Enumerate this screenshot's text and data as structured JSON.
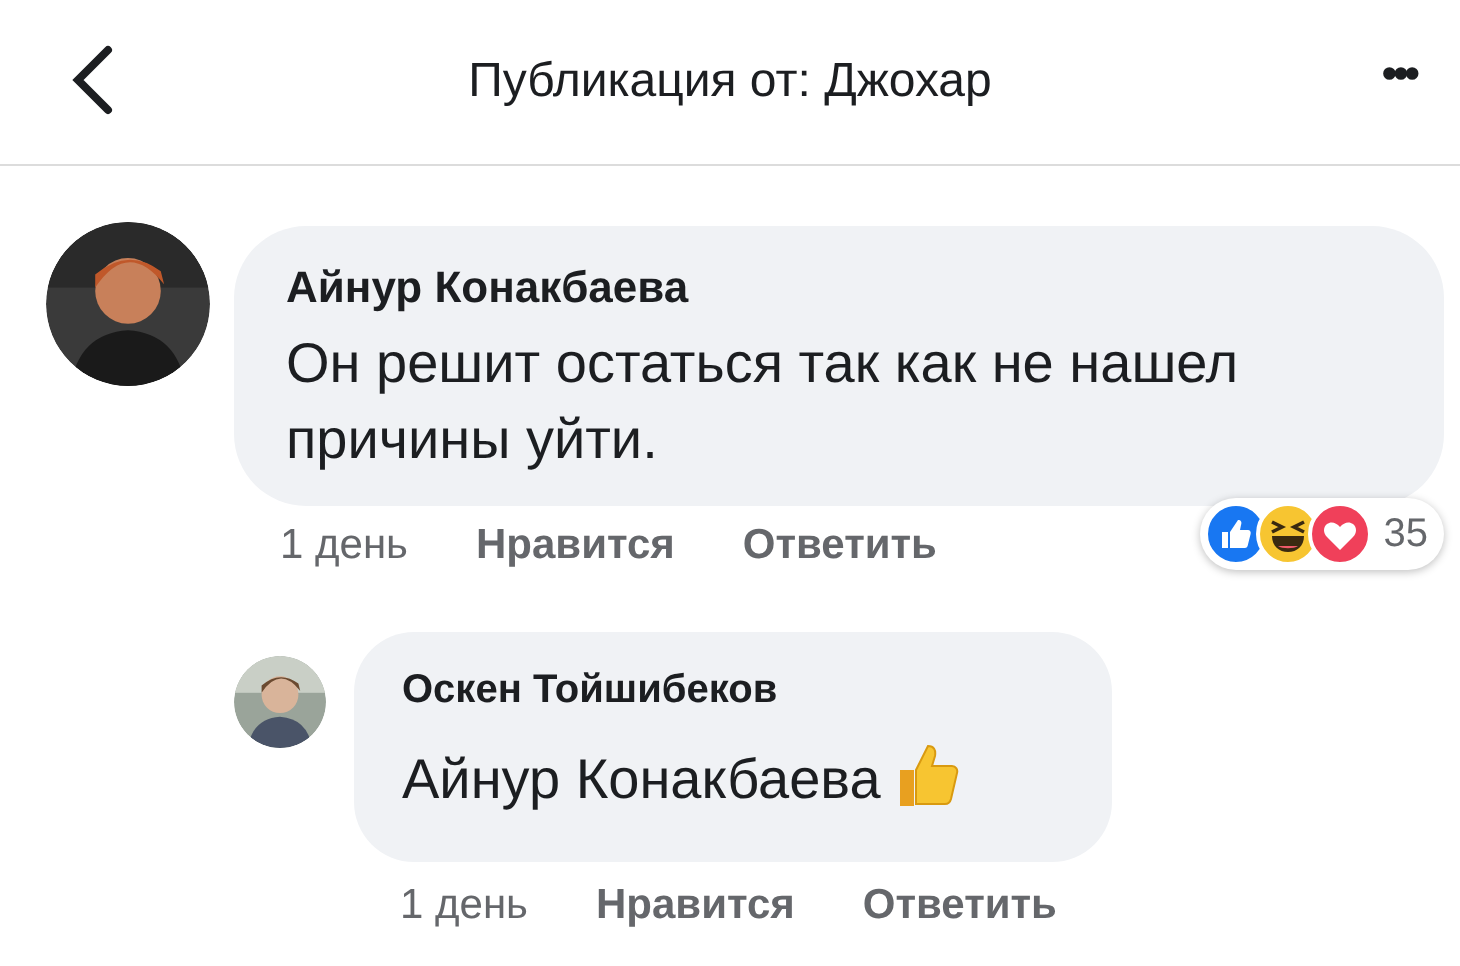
{
  "header": {
    "title": "Публикация от: Джохар",
    "more": "•••"
  },
  "comments": [
    {
      "kind": "comment",
      "avatar": {
        "kind": "picture"
      },
      "author": "Айнур Конакбаева",
      "text": "Он решит остаться так как не нашел причины уйти.",
      "time": "1 день",
      "like": "Нравится",
      "reply": "Ответить",
      "reactions": [
        {
          "kind": "like"
        },
        {
          "kind": "haha"
        },
        {
          "kind": "love"
        }
      ],
      "reaction_count": "35"
    },
    {
      "kind": "reply",
      "avatar": {
        "kind": "picture"
      },
      "author": "Оскен Тойшибеков",
      "text": "Айнур Конакбаева",
      "icons": [
        {
          "kind": "thumbs_up"
        }
      ],
      "time": "1 день",
      "like": "Нравится",
      "reply": "Ответить"
    }
  ]
}
